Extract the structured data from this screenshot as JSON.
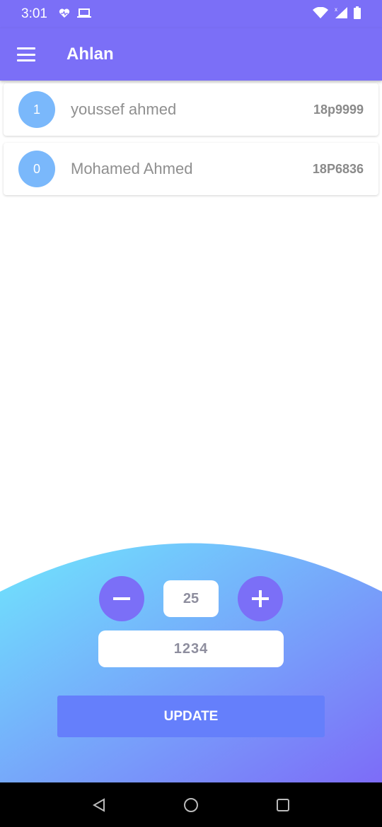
{
  "status_bar": {
    "time": "3:01",
    "left_icons": [
      "heart-pulse-icon",
      "laptop-icon"
    ],
    "right_icons": [
      "wifi-icon",
      "signal-icon",
      "battery-icon"
    ]
  },
  "app_bar": {
    "title": "Ahlan",
    "menu_icon": "menu-icon"
  },
  "list": {
    "items": [
      {
        "avatar_text": "1",
        "name": "youssef ahmed",
        "code": "18p9999"
      },
      {
        "avatar_text": "0",
        "name": "Mohamed Ahmed",
        "code": "18P6836"
      }
    ]
  },
  "controls": {
    "quantity": "25",
    "code_value": "1234",
    "update_label": "UPDATE"
  },
  "colors": {
    "primary": "#7b6ff7",
    "avatar": "#7ab8fb",
    "button": "#657ffb",
    "gradient_start": "#6fe6fd",
    "gradient_end": "#7d6cf8"
  },
  "nav_bar": {
    "icons": [
      "back-icon",
      "home-icon",
      "recents-icon"
    ]
  }
}
